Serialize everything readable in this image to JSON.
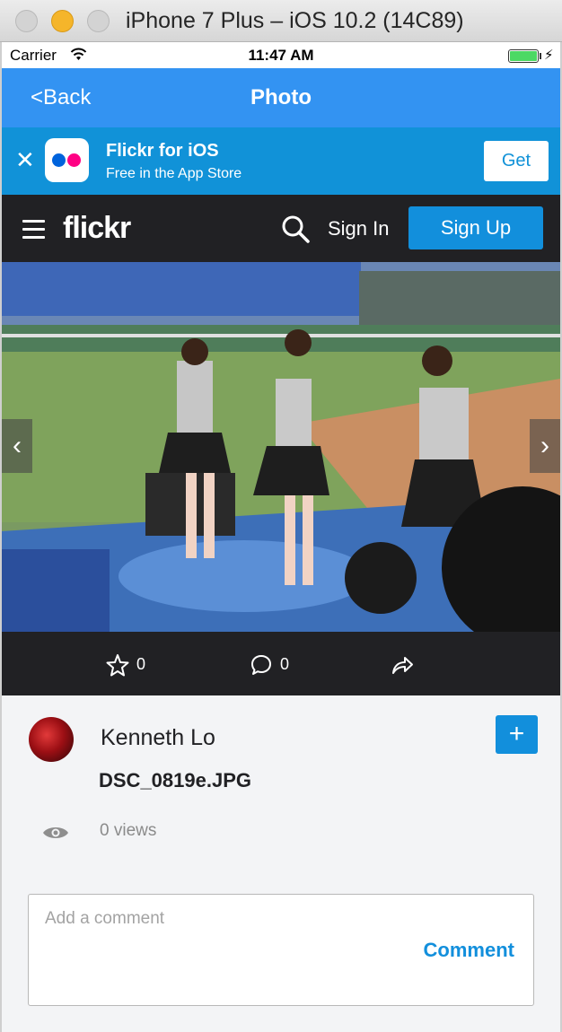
{
  "window": {
    "title": "iPhone 7 Plus – iOS 10.2 (14C89)"
  },
  "status_bar": {
    "carrier": "Carrier",
    "time": "11:47 AM",
    "battery_level": 1.0
  },
  "nav": {
    "back_label": "<Back",
    "title": "Photo"
  },
  "app_banner": {
    "close_glyph": "✕",
    "app_name": "Flickr for iOS",
    "subtitle": "Free in the App Store",
    "get_label": "Get"
  },
  "flickr_header": {
    "logo": "flickr",
    "signin_label": "Sign In",
    "signup_label": "Sign Up"
  },
  "photo": {
    "prev_glyph": "‹",
    "next_glyph": "›"
  },
  "actions": {
    "favorites_count": "0",
    "comments_count": "0"
  },
  "details": {
    "author": "Kenneth Lo",
    "follow_glyph": "+",
    "filename": "DSC_0819e.JPG",
    "views": "0 views",
    "comment_placeholder": "Add a comment",
    "comment_button": "Comment"
  },
  "colors": {
    "nav_blue": "#3393f2",
    "banner_blue": "#1192d8",
    "flickr_blue": "#128fdc",
    "flickr_dark": "#212124",
    "flickr_pink": "#ff0084",
    "flickr_logo_blue": "#0063dc"
  },
  "icons": [
    "wifi-icon",
    "battery-icon",
    "close-icon",
    "flickr-app-icon",
    "hamburger-icon",
    "search-icon",
    "chevron-left-icon",
    "chevron-right-icon",
    "star-icon",
    "comment-icon",
    "share-icon",
    "avatar",
    "plus-icon",
    "eye-icon"
  ]
}
